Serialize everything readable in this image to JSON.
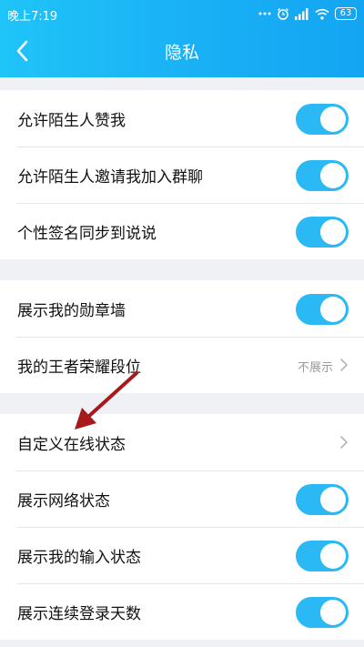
{
  "status_bar": {
    "time": "晚上7:19",
    "battery": "63"
  },
  "nav": {
    "title": "隐私"
  },
  "groups": [
    {
      "rows": [
        {
          "label": "允许陌生人赞我",
          "toggle": true
        },
        {
          "label": "允许陌生人邀请我加入群聊",
          "toggle": true
        },
        {
          "label": "个性签名同步到说说",
          "toggle": true
        }
      ]
    },
    {
      "rows": [
        {
          "label": "展示我的勋章墙",
          "toggle": true
        },
        {
          "label": "我的王者荣耀段位",
          "value": "不展示"
        }
      ]
    },
    {
      "rows": [
        {
          "label": "自定义在线状态"
        },
        {
          "label": "展示网络状态",
          "toggle": true
        },
        {
          "label": "展示我的输入状态",
          "toggle": true
        },
        {
          "label": "展示连续登录天数",
          "toggle": true
        }
      ]
    }
  ],
  "colors": {
    "header": "#19b0f5",
    "toggle_on": "#2bb9f5",
    "annotation_arrow": "#a8191c"
  },
  "icons": {
    "back": "chevron-left-icon",
    "chevron": "chevron-right-icon",
    "alarm": "alarm-icon",
    "signal": "signal-icon",
    "wifi": "wifi-icon",
    "battery": "battery-icon"
  }
}
